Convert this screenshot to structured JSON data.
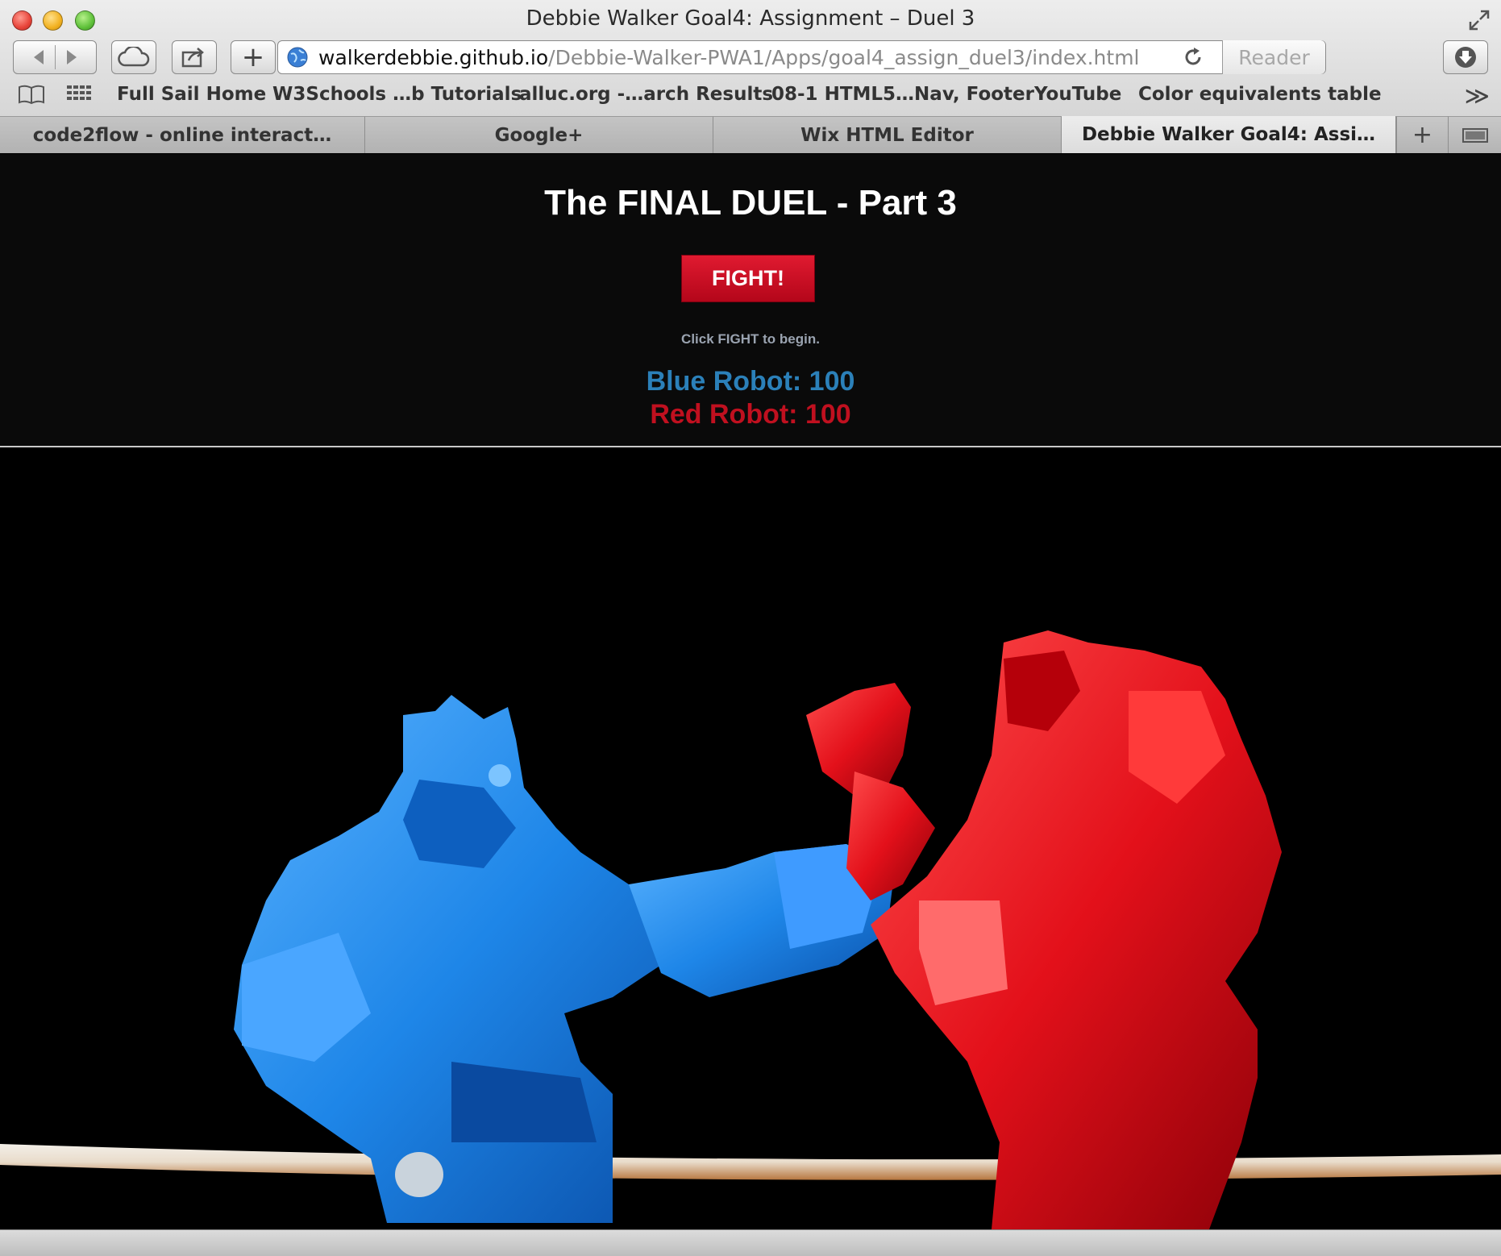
{
  "window": {
    "title": "Debbie Walker Goal4: Assignment – Duel 3"
  },
  "toolbar": {
    "url_host": "walkerdebbie.github.io",
    "url_path": "/Debbie-Walker-PWA1/Apps/goal4_assign_duel3/index.html",
    "reader_label": "Reader"
  },
  "bookmarks": [
    "Full Sail Home",
    "W3Schools …b Tutorials",
    "alluc.org -…arch Results",
    "08-1 HTML5…Nav, Footer",
    "YouTube",
    "Color equivalents table"
  ],
  "tabs": [
    {
      "label": "code2flow - online interact…",
      "active": false
    },
    {
      "label": "Google+",
      "active": false
    },
    {
      "label": "Wix HTML Editor",
      "active": false
    },
    {
      "label": "Debbie Walker Goal4: Assi…",
      "active": true
    }
  ],
  "page": {
    "title": "The FINAL DUEL - Part 3",
    "fight_button": "FIGHT!",
    "status": "Click FIGHT to begin.",
    "blue_score": "Blue Robot: 100",
    "red_score": "Red Robot: 100"
  },
  "colors": {
    "blue_robot": "#2b80b9",
    "red_robot": "#c0101f",
    "fight_button": "#d0102a"
  },
  "icons": [
    "back-icon",
    "forward-icon",
    "icloud-tabs-icon",
    "share-icon",
    "add-bookmark-icon",
    "globe-icon",
    "reload-icon",
    "downloads-icon",
    "reading-list-icon",
    "top-sites-icon",
    "more-bookmarks-icon",
    "new-tab-icon",
    "tab-overview-icon",
    "fullscreen-icon"
  ]
}
